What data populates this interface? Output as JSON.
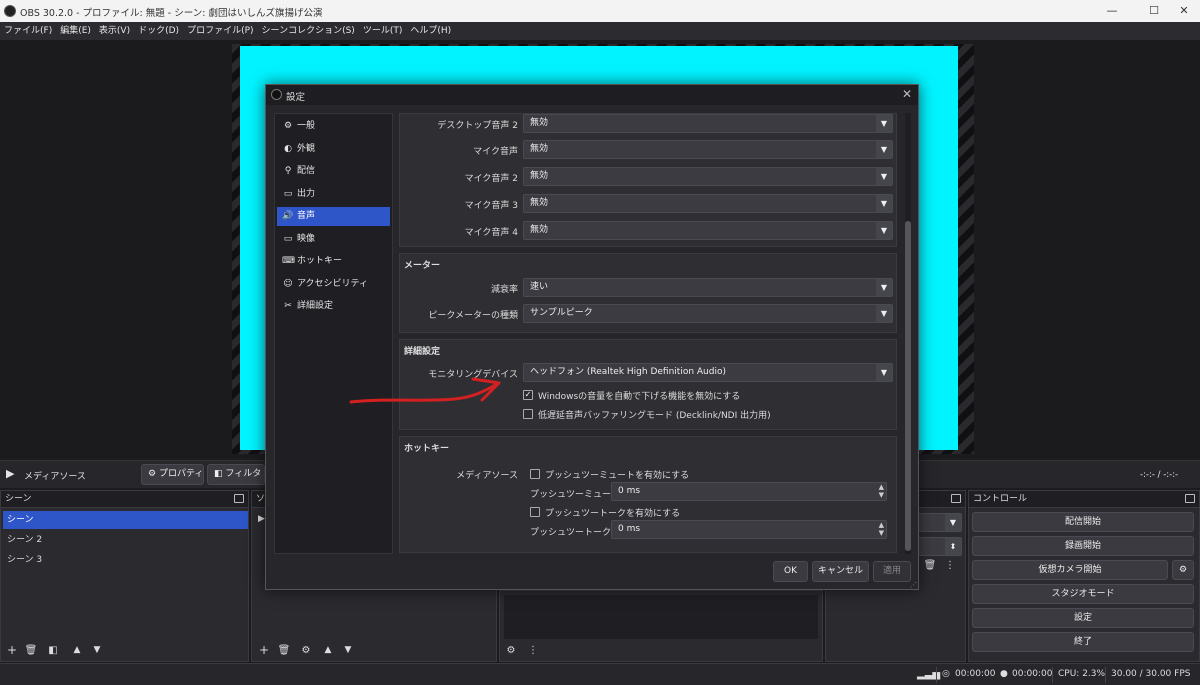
{
  "window": {
    "title": "OBS 30.2.0 - プロファイル: 無題 - シーン: 劇団はいしんズ旗揚げ公演",
    "minimize": "—",
    "maximize": "☐",
    "close": "✕"
  },
  "menu": [
    "ファイル(F)",
    "編集(E)",
    "表示(V)",
    "ドック(D)",
    "プロファイル(P)",
    "シーンコレクション(S)",
    "ツール(T)",
    "ヘルプ(H)"
  ],
  "source_toolbar": {
    "source_name": "メディアソース",
    "properties_label": "プロパティ",
    "filters_label": "フィルタ",
    "time": "-:-:-  /  -:-:-"
  },
  "scenes_dock": {
    "title": "シーン",
    "items": [
      "シーン",
      "シーン 2",
      "シーン 3"
    ],
    "selected": 0
  },
  "sources_dock": {
    "title": "ソ"
  },
  "controls_dock": {
    "title": "コントロール",
    "buttons": [
      "配信開始",
      "録画開始",
      "仮想カメラ開始",
      "スタジオモード",
      "設定",
      "終了"
    ]
  },
  "statusbar": {
    "stream_time": "00:00:00",
    "record_time": "00:00:00",
    "cpu": "CPU: 2.3%",
    "fps": "30.00 / 30.00 FPS"
  },
  "settings_dialog": {
    "title": "設定",
    "close": "✕",
    "sidebar": [
      {
        "label": "一般",
        "icon": "gear-icon",
        "glyph": "⚙"
      },
      {
        "label": "外観",
        "icon": "palette-icon",
        "glyph": "◐"
      },
      {
        "label": "配信",
        "icon": "antenna-icon",
        "glyph": "⚲"
      },
      {
        "label": "出力",
        "icon": "output-icon",
        "glyph": "▭"
      },
      {
        "label": "音声",
        "icon": "speaker-icon",
        "glyph": "🔊"
      },
      {
        "label": "映像",
        "icon": "monitor-icon",
        "glyph": "▭"
      },
      {
        "label": "ホットキー",
        "icon": "keyboard-icon",
        "glyph": "⌨"
      },
      {
        "label": "アクセシビリティ",
        "icon": "accessibility-icon",
        "glyph": "☺"
      },
      {
        "label": "詳細設定",
        "icon": "tools-icon",
        "glyph": "✂"
      }
    ],
    "selected_index": 4,
    "audio_devices": [
      {
        "label": "デスクトップ音声 2",
        "value": "無効"
      },
      {
        "label": "マイク音声",
        "value": "無効"
      },
      {
        "label": "マイク音声 2",
        "value": "無効"
      },
      {
        "label": "マイク音声 3",
        "value": "無効"
      },
      {
        "label": "マイク音声 4",
        "value": "無効"
      }
    ],
    "meters": {
      "title": "メーター",
      "decay_label": "減衰率",
      "decay_value": "速い",
      "peak_label": "ピークメーターの種類",
      "peak_value": "サンプルピーク"
    },
    "advanced": {
      "title": "詳細設定",
      "monitoring_label": "モニタリングデバイス",
      "monitoring_value": "ヘッドフォン (Realtek High Definition Audio)",
      "ducking_label": "Windowsの音量を自動で下げる機能を無効にする",
      "ducking_checked": "✓",
      "lowlatency_label": "低遅延音声バッファリングモード (Decklink/NDI 出力用)"
    },
    "hotkeys": {
      "title": "ホットキー",
      "source_label": "メディアソース",
      "ptm_enable": "プッシュツーミュートを有効にする",
      "ptm_delay_label": "プッシュツーミュート遅延",
      "ptm_delay_value": "0 ms",
      "ptt_enable": "プッシュツートークを有効にする",
      "ptt_delay_label": "プッシュツートーク遅延",
      "ptt_delay_value": "0 ms"
    },
    "buttons": {
      "ok": "OK",
      "cancel": "キャンセル",
      "apply": "適用"
    }
  },
  "colors": {
    "accent": "#2f56c9",
    "preview": "#00f3ff",
    "annotation": "#d42020"
  }
}
